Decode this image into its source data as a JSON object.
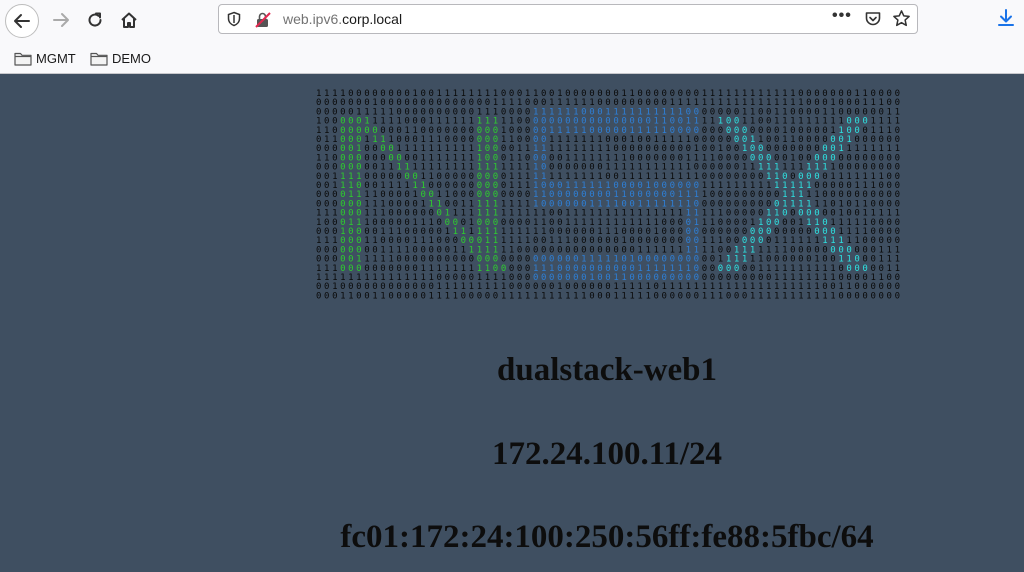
{
  "browser": {
    "url_host": "web.ipv6.",
    "url_domain": "corp.local",
    "more_label": "•••",
    "bookmarks": [
      {
        "label": "MGMT"
      },
      {
        "label": "DEMO"
      }
    ]
  },
  "page": {
    "hostname": "dualstack-web1",
    "ipv4": "172.24.100.11/24",
    "ipv6": "fc01:172:24:100:250:56ff:fe88:5fbc/64"
  },
  "colors": {
    "background": "#3f4f61",
    "binary_text": "#0a0a0a",
    "logo_n": "#2ecc2e",
    "logo_s": "#2e7fd6",
    "logo_x": "#2ee0e0"
  },
  "ascii_art": {
    "logo_letters": "NSX"
  }
}
